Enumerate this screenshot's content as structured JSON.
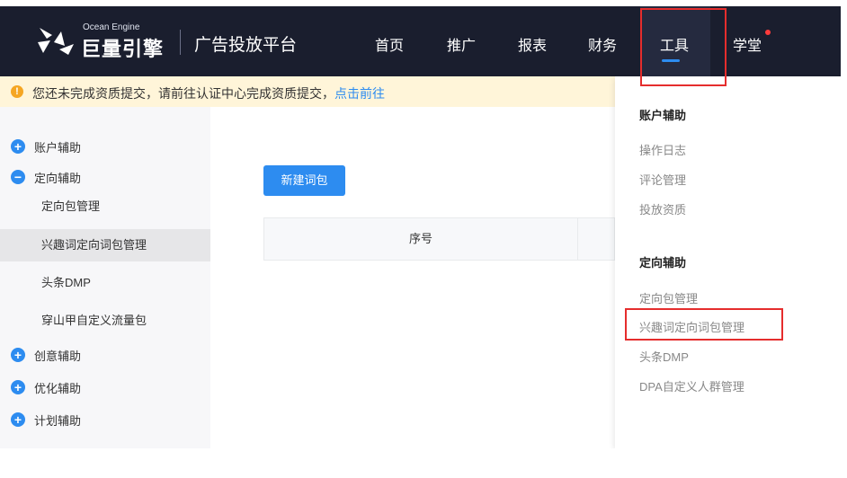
{
  "header": {
    "brand_en": "Ocean Engine",
    "brand_cn": "巨量引擎",
    "platform": "广告投放平台",
    "nav": [
      "首页",
      "推广",
      "报表",
      "财务",
      "工具",
      "学堂"
    ],
    "active": "工具",
    "colors": {
      "bg": "#1a1e2e",
      "accent": "#2d8cf0",
      "dot": "#ff3b3b"
    }
  },
  "notice": {
    "text": "您还未完成资质提交，请前往认证中心完成资质提交，",
    "link": "点击前往"
  },
  "sidebar": {
    "groups": [
      {
        "label": "账户辅助",
        "icon": "plus-circle-icon"
      },
      {
        "label": "定向辅助",
        "icon": "minus-circle-icon"
      },
      {
        "label": "创意辅助",
        "icon": "plus-circle-icon"
      },
      {
        "label": "优化辅助",
        "icon": "plus-circle-icon"
      },
      {
        "label": "计划辅助",
        "icon": "plus-circle-icon"
      }
    ],
    "sub_items": [
      "定向包管理",
      "兴趣词定向词包管理",
      "头条DMP",
      "穿山甲自定义流量包"
    ],
    "active_sub": "兴趣词定向词包管理"
  },
  "main": {
    "new_button": "新建词包",
    "table_header": [
      "序号"
    ]
  },
  "dropdown": {
    "sections": [
      {
        "title": "账户辅助",
        "items": [
          "操作日志",
          "评论管理",
          "投放资质"
        ]
      },
      {
        "title": "定向辅助",
        "items": [
          "定向包管理",
          "兴趣词定向词包管理",
          "头条DMP",
          "DPA自定义人群管理"
        ]
      }
    ]
  }
}
